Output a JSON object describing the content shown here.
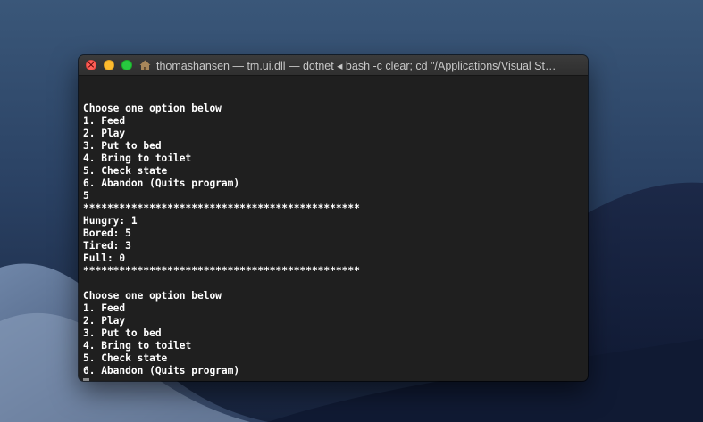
{
  "window": {
    "title": "thomashansen — tm.ui.dll — dotnet ◂ bash -c clear; cd \"/Applications/Visual St…",
    "home_icon": "house-icon"
  },
  "terminal": {
    "lines": [
      "",
      "Choose one option below",
      "1. Feed",
      "2. Play",
      "3. Put to bed",
      "4. Bring to toilet",
      "5. Check state",
      "6. Abandon (Quits program)",
      "5",
      "**********************************************",
      "Hungry: 1",
      "Bored: 5",
      "Tired: 3",
      "Full: 0",
      "**********************************************",
      "",
      "Choose one option below",
      "1. Feed",
      "2. Play",
      "3. Put to bed",
      "4. Bring to toilet",
      "5. Check state",
      "6. Abandon (Quits program)"
    ]
  },
  "colors": {
    "close": "#ff5f57",
    "minimize": "#febc2e",
    "maximize": "#28c840",
    "terminal_bg": "#1f1f1f",
    "terminal_text": "#ffffff"
  }
}
